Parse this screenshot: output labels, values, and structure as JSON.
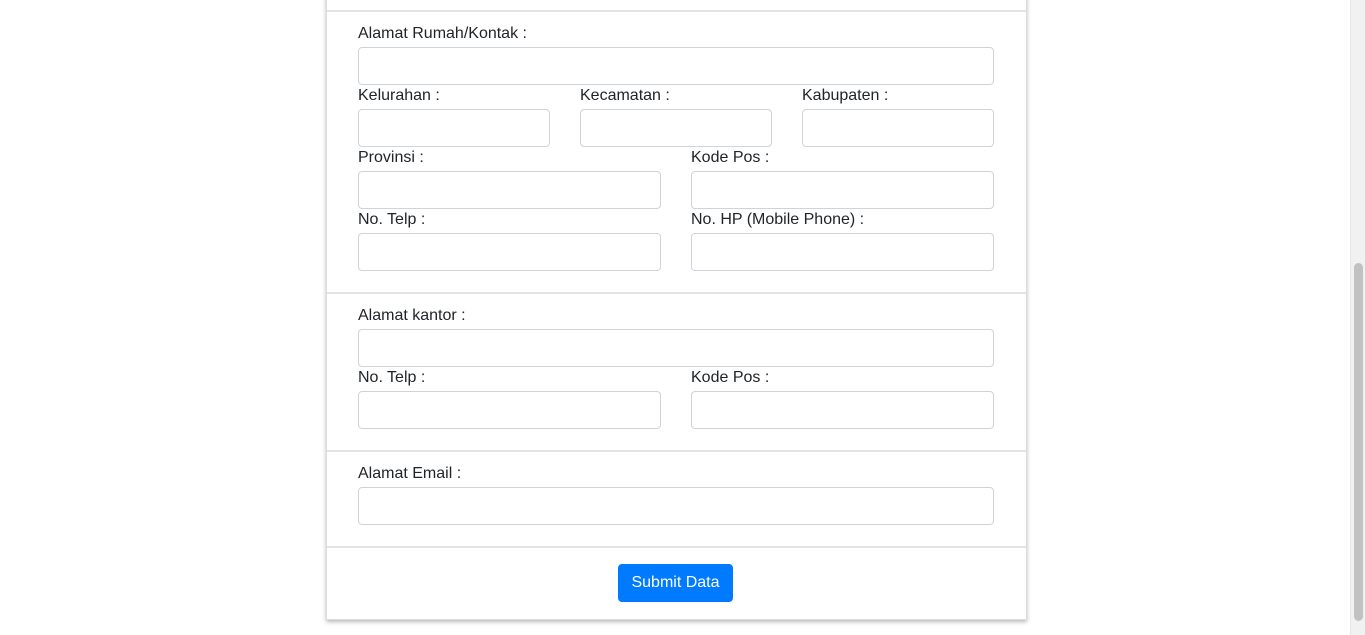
{
  "home_address": {
    "address_label": "Alamat Rumah/Kontak :",
    "kelurahan_label": "Kelurahan :",
    "kecamatan_label": "Kecamatan :",
    "kabupaten_label": "Kabupaten :",
    "provinsi_label": "Provinsi :",
    "kode_pos_label": "Kode Pos :",
    "telp_label": "No. Telp :",
    "hp_label": "No. HP (Mobile Phone) :"
  },
  "office_address": {
    "address_label": "Alamat kantor :",
    "telp_label": "No. Telp :",
    "kode_pos_label": "Kode Pos :"
  },
  "email": {
    "label": "Alamat Email :"
  },
  "submit": {
    "label": "Submit Data"
  },
  "colors": {
    "primary_button": "#007bff",
    "input_border": "#ced4da"
  }
}
